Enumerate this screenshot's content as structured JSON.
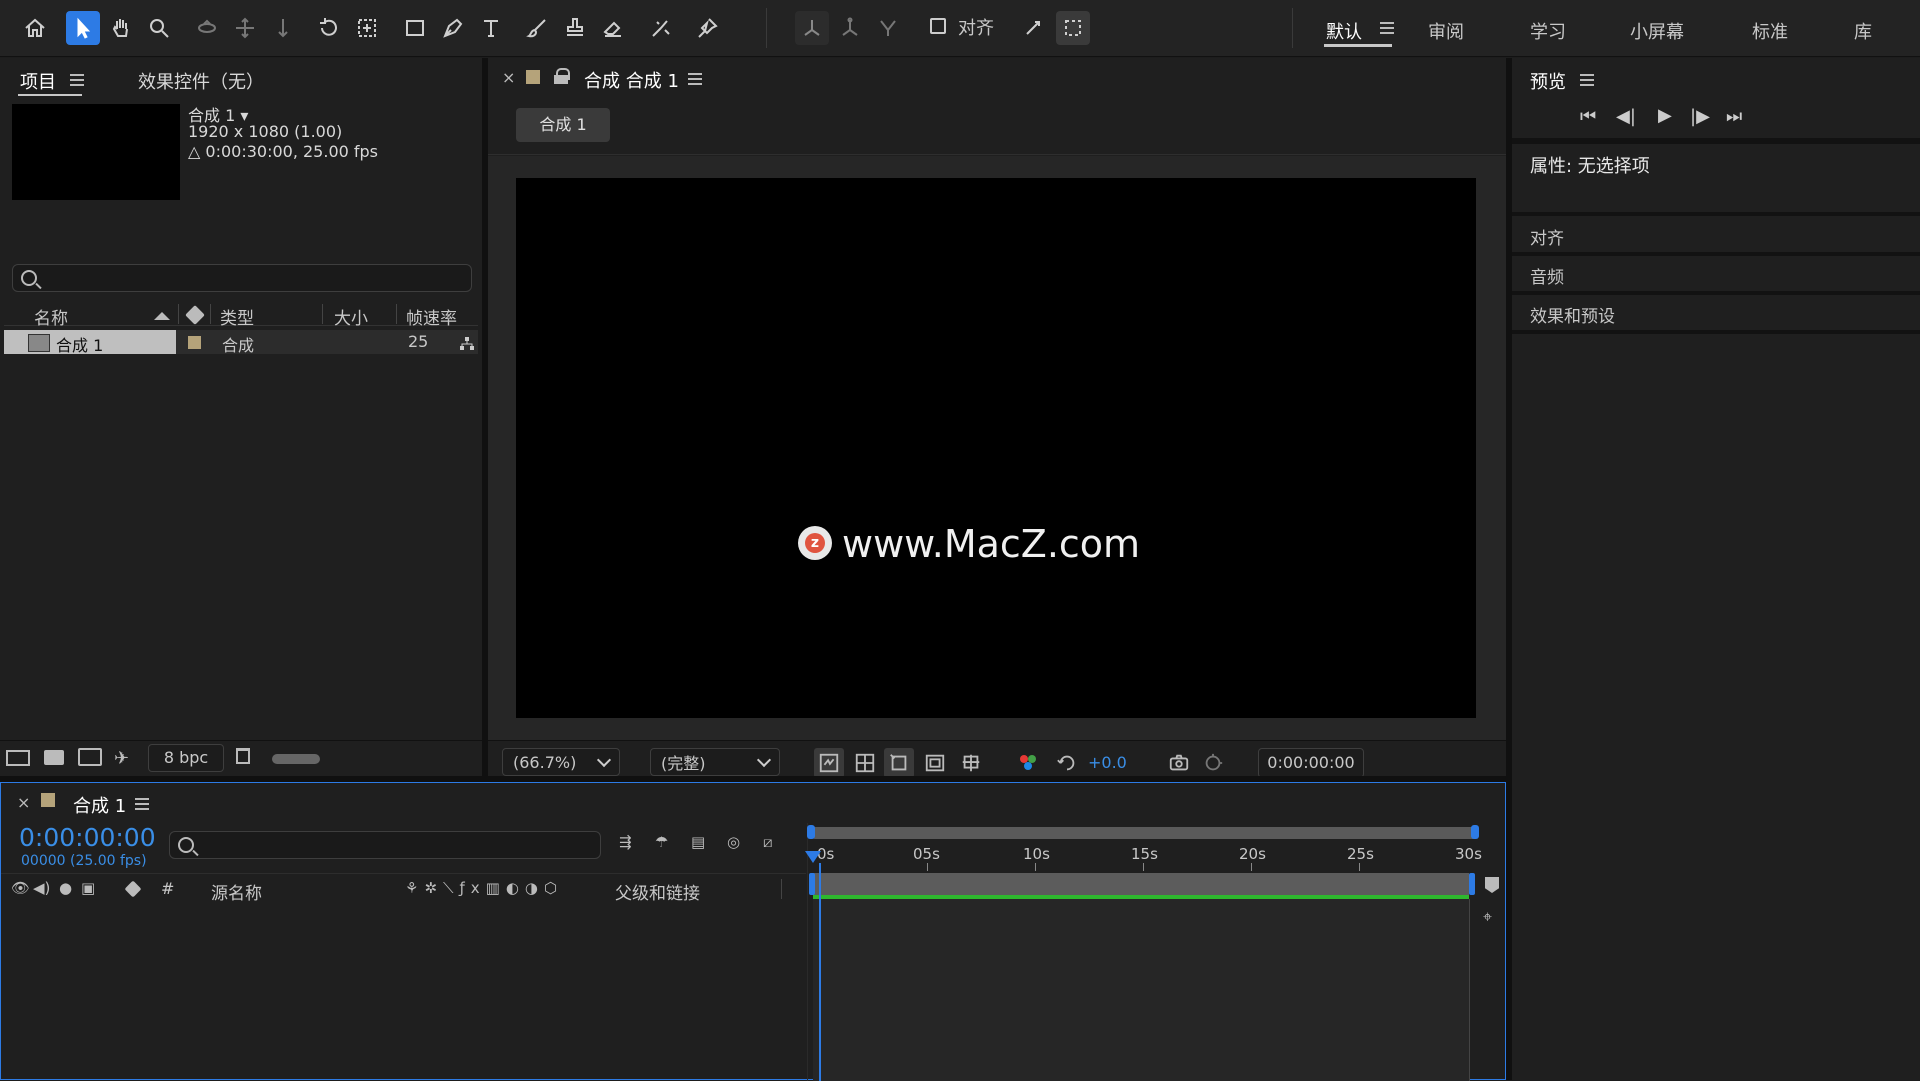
{
  "toolbar": {
    "tools": [
      "home-icon",
      "selection-tool-icon",
      "hand-tool-icon",
      "zoom-tool-icon",
      "orbit-camera-icon",
      "pan-camera-icon",
      "dolly-camera-icon",
      "rotate-tool-icon",
      "pan-behind-tool-icon",
      "rectangle-tool-icon",
      "pen-tool-icon",
      "type-tool-icon",
      "brush-tool-icon",
      "clone-stamp-tool-icon",
      "eraser-tool-icon",
      "roto-brush-tool-icon",
      "puppet-pin-tool-icon"
    ],
    "align_label": "对齐"
  },
  "workspaces": {
    "items": [
      "默认",
      "审阅",
      "学习",
      "小屏幕",
      "标准",
      "库"
    ],
    "active": "默认"
  },
  "project_panel": {
    "tab_title": "项目",
    "effects_tab": "效果控件（无）",
    "comp_name": "合成 1 ▾",
    "comp_size": "1920 x 1080 (1.00)",
    "comp_duration": "△ 0:00:30:00, 25.00 fps",
    "columns": {
      "name": "名称",
      "type": "类型",
      "size": "大小",
      "fps": "帧速率"
    },
    "rows": [
      {
        "name": "合成 1",
        "type": "合成",
        "size": "",
        "fps": "25"
      }
    ],
    "bpc": "8 bpc"
  },
  "composition_panel": {
    "tab_title": "合成 合成 1",
    "breadcrumb": "合成 1",
    "watermark": "www.MacZ.com",
    "zoom": "(66.7%)",
    "resolution": "(完整)",
    "exposure": "+0.0",
    "timecode": "0:00:00:00"
  },
  "right_panel": {
    "preview_title": "预览",
    "properties_label": "属性: 无选择项",
    "sections": [
      "对齐",
      "音频",
      "效果和预设"
    ]
  },
  "timeline": {
    "tab_title": "合成 1",
    "timecode": "0:00:00:00",
    "frames": "00000 (25.00 fps)",
    "col_num": "#",
    "col_source": "源名称",
    "col_parent": "父级和链接",
    "ruler": [
      "0s",
      "05s",
      "10s",
      "15s",
      "20s",
      "25s",
      "30s"
    ]
  },
  "colors": {
    "accent": "#2d7be5",
    "timecode_blue": "#3a8ee6",
    "comp_label": "#b5a37a",
    "work_area_green": "#2eb82e"
  }
}
